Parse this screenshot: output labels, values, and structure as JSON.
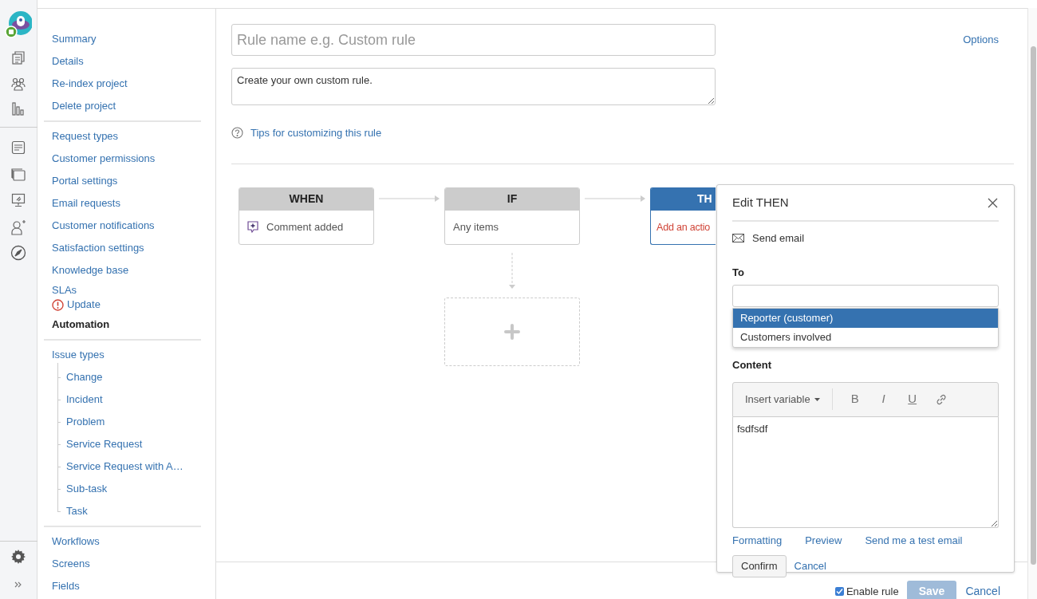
{
  "sidebar": {
    "groups": [
      {
        "items": [
          {
            "label": "Summary",
            "selected": false
          },
          {
            "label": "Details",
            "selected": false
          },
          {
            "label": "Re-index project",
            "selected": false
          },
          {
            "label": "Delete project",
            "selected": false
          }
        ]
      },
      {
        "items": [
          {
            "label": "Request types",
            "selected": false
          },
          {
            "label": "Customer permissions",
            "selected": false
          },
          {
            "label": "Portal settings",
            "selected": false
          },
          {
            "label": "Email requests",
            "selected": false
          },
          {
            "label": "Customer notifications",
            "selected": false
          },
          {
            "label": "Satisfaction settings",
            "selected": false
          },
          {
            "label": "Knowledge base",
            "selected": false
          },
          {
            "label": "SLAs",
            "selected": false,
            "alert": "Update"
          },
          {
            "label": "Automation",
            "selected": true
          }
        ]
      },
      {
        "items": [
          {
            "label": "Issue types",
            "selected": false,
            "children": [
              {
                "label": "Change",
                "selected": false
              },
              {
                "label": "Incident",
                "selected": false
              },
              {
                "label": "Problem",
                "selected": false
              },
              {
                "label": "Service Request",
                "selected": false
              },
              {
                "label": "Service Request with A…",
                "selected": false
              },
              {
                "label": "Sub-task",
                "selected": false
              },
              {
                "label": "Task",
                "selected": false
              }
            ]
          }
        ]
      },
      {
        "items": [
          {
            "label": "Workflows",
            "selected": false
          },
          {
            "label": "Screens",
            "selected": false
          },
          {
            "label": "Fields",
            "selected": false
          }
        ]
      }
    ]
  },
  "rule": {
    "name_placeholder": "Rule name e.g. Custom rule",
    "description": "Create your own custom rule.",
    "tips_link": "Tips for customizing this rule",
    "options_link": "Options"
  },
  "flow": [
    {
      "kind": "step",
      "title": "WHEN",
      "body": "Comment added",
      "active": false,
      "warning": false
    },
    {
      "kind": "step",
      "title": "IF",
      "body": "Any items",
      "active": false,
      "warning": false
    },
    {
      "kind": "step",
      "title": "TH",
      "body": "Add an actio",
      "active": true,
      "warning": true
    }
  ],
  "edit_panel": {
    "title": "Edit THEN",
    "action": "Send email",
    "to_label": "To",
    "to_options": [
      {
        "label": "Reporter (customer)",
        "selected": true
      },
      {
        "label": "Customers involved",
        "selected": false
      }
    ],
    "content_label": "Content",
    "insert_variable": "Insert variable",
    "format_buttons": [
      {
        "kind": "bold",
        "label": "B"
      },
      {
        "kind": "italic",
        "label": "I"
      },
      {
        "kind": "underline",
        "label": "U"
      },
      {
        "kind": "link"
      }
    ],
    "content": "fsdfsdf",
    "links": [
      "Formatting",
      "Preview",
      "Send me a test email"
    ],
    "confirm": "Confirm",
    "cancel": "Cancel"
  },
  "footer": {
    "enable_rule": {
      "label": "Enable rule",
      "checked": true
    },
    "save": "Save",
    "cancel": "Cancel"
  }
}
